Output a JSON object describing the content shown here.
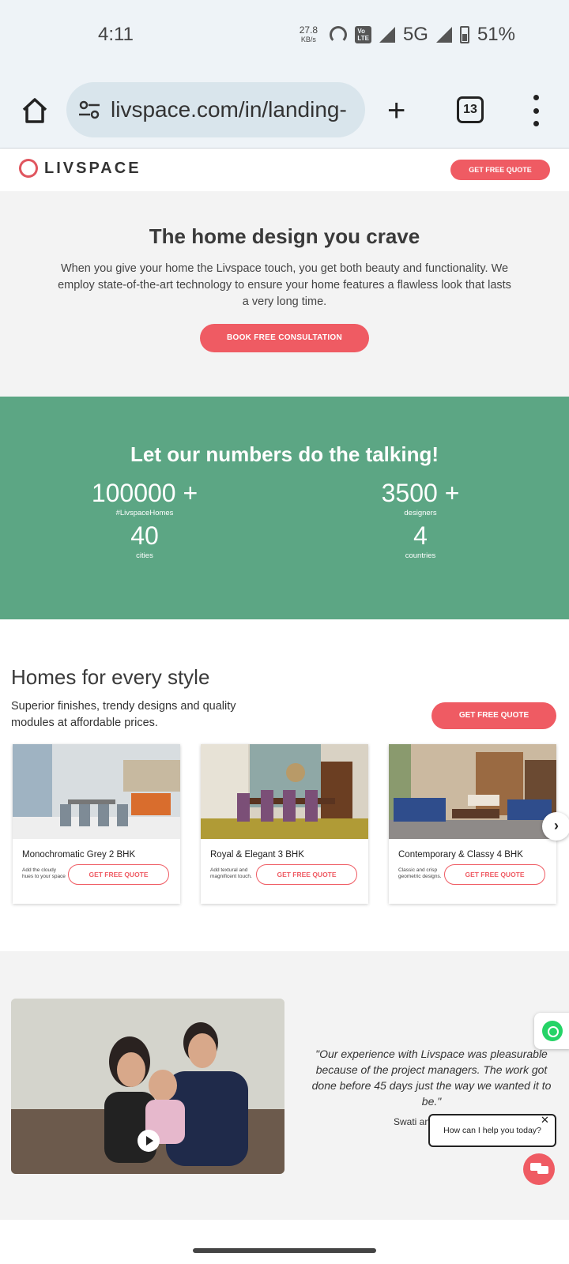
{
  "status_bar": {
    "time": "4:11",
    "speed_value": "27.8",
    "speed_unit": "KB/s",
    "network": "5G",
    "battery": "51%"
  },
  "browser": {
    "url": "livspace.com/in/landing-",
    "tab_count": "13"
  },
  "header": {
    "logo": "LIVSPACE",
    "quote_button": "GET FREE QUOTE"
  },
  "hero": {
    "title": "The home design you crave",
    "text": "When you give your home the Livspace touch, you get both beauty and functionality. We employ state-of-the-art technology to ensure your home features a flawless look that lasts a very long time.",
    "button": "BOOK FREE CONSULTATION"
  },
  "stats": {
    "title": "Let our numbers do the talking!",
    "items": [
      {
        "value": "100000 +",
        "label": "#LivspaceHomes"
      },
      {
        "value": "3500 +",
        "label": "designers"
      },
      {
        "value": "40",
        "label": "cities"
      },
      {
        "value": "4",
        "label": "countries"
      }
    ]
  },
  "homes": {
    "title": "Homes for every style",
    "subtitle": "Superior finishes, trendy designs and quality modules at affordable prices.",
    "button": "GET FREE QUOTE",
    "cards": [
      {
        "title": "Monochromatic Grey 2 BHK",
        "desc": "Add the cloudy hues to your space",
        "button": "GET FREE QUOTE"
      },
      {
        "title": "Royal & Elegant 3 BHK",
        "desc": "Add textural and magnificent touch.",
        "button": "GET FREE QUOTE"
      },
      {
        "title": "Contemporary & Classy 4 BHK",
        "desc": "Classic and crisp geometric designs.",
        "button": "GET FREE QUOTE"
      }
    ]
  },
  "testimonial": {
    "quote": "\"Our experience with Livspace was pleasurable because of the project managers. The work got done before 45 days just the way we wanted it to be.\"",
    "author": "Swati an"
  },
  "chat": {
    "prompt": "How can I help you today?"
  },
  "colors": {
    "accent": "#ef5b63",
    "stats_bg": "#5ca684",
    "section_bg": "#f3f3f3"
  }
}
